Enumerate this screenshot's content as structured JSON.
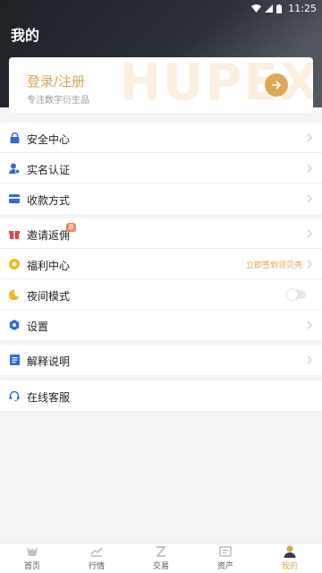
{
  "status": {
    "time": "11:25"
  },
  "header": {
    "title": "我的"
  },
  "login": {
    "title": "登录/注册",
    "subtitle": "专注数字衍生品",
    "watermark": "HUPEX",
    "arrow_icon": "arrow-right-icon"
  },
  "groups": [
    {
      "items": [
        {
          "label": "安全中心",
          "icon": "lock-icon"
        },
        {
          "label": "实名认证",
          "icon": "user-verify-icon"
        },
        {
          "label": "收款方式",
          "icon": "card-icon"
        }
      ]
    },
    {
      "items": [
        {
          "label": "邀请返佣",
          "icon": "gift-icon",
          "badge": "邀"
        },
        {
          "label": "福利中心",
          "icon": "coin-icon",
          "hint": "立即签到领贝壳"
        },
        {
          "label": "夜间模式",
          "icon": "moon-icon",
          "toggle": false
        },
        {
          "label": "设置",
          "icon": "settings-icon"
        }
      ]
    },
    {
      "items": [
        {
          "label": "解释说明",
          "icon": "doc-icon"
        }
      ]
    },
    {
      "items": [
        {
          "label": "在线客服",
          "icon": "headset-icon"
        }
      ]
    }
  ],
  "tabs": [
    {
      "label": "首页",
      "icon": "home-icon"
    },
    {
      "label": "行情",
      "icon": "chart-icon"
    },
    {
      "label": "交易",
      "icon": "exchange-icon"
    },
    {
      "label": "资产",
      "icon": "wallet-icon"
    },
    {
      "label": "我的",
      "icon": "profile-icon",
      "active": true
    }
  ],
  "colors": {
    "accent": "#d7a55a",
    "icon_blue": "#2f6bd6",
    "icon_red": "#e2473f",
    "icon_yellow": "#f2b824",
    "hint_orange": "#e7a34b"
  }
}
